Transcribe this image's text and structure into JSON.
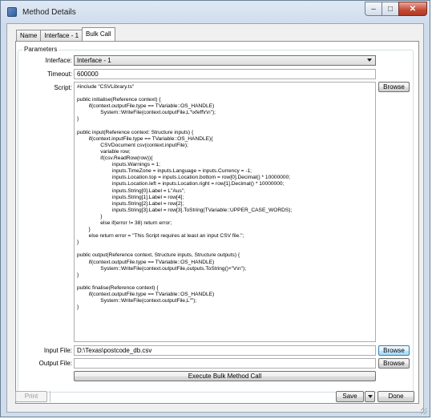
{
  "window": {
    "title": "Method Details",
    "minimize": "‒",
    "maximize": "□",
    "close": "✕"
  },
  "tabs": [
    "Name",
    "Interface - 1",
    "Bulk Call"
  ],
  "group": {
    "title": "Parameters"
  },
  "form": {
    "interface_label": "Interface:",
    "interface_value": "Interface - 1",
    "timeout_label": "Timeout:",
    "timeout_value": "600000",
    "script_label": "Script:",
    "script_lines": [
      "#include \"CSVLibrary.ts\"",
      "",
      "public initialise(Reference context) {",
      "\t\tif(context.outputFile.type == TVariable::OS_HANDLE)",
      "\t\t\t\tSystem::WriteFile(context.outputFile,L\"\\xfeff\\r\\n\");",
      "}",
      "",
      "public input(Reference context: Structure inputs) {",
      "\t\tif(context.inputFile.type == TVariable::OS_HANDLE){",
      "\t\t\t\tCSVDocument csv(context.inputFile);",
      "\t\t\t\tvariable row;",
      "\t\t\t\tif(csv.ReadRow(row)){",
      "\t\t\t\t\t\tinputs.Warnings = 1;",
      "\t\t\t\t\t\tinputs.TimeZone = inputs.Language = inputs.Currency = -1;",
      "\t\t\t\t\t\tinputs.Location.top = inputs.Location.bottom = row[0].Decimal() * 10000000;",
      "\t\t\t\t\t\tinputs.Location.left = inputs.Location.right = row[1].Decimal() * 10000000;",
      "\t\t\t\t\t\tinputs.String[0].Label = L\"Aus\";",
      "\t\t\t\t\t\tinputs.String[1].Label = row[4];",
      "\t\t\t\t\t\tinputs.String[2].Label = row[2];",
      "\t\t\t\t\t\tinputs.String[3].Label = row[3].ToString(TVariable::UPPER_CASE_WORDS);",
      "\t\t\t\t}",
      "\t\t\t\telse if(error != 38) return error;",
      "\t\t}",
      "\t\telse return error = \"This Script requires at least an input CSV file.\";",
      "}",
      "",
      "public output(Reference context, Structure inputs, Structure outputs) {",
      "\t\tif(context.outputFile.type == TVariable::OS_HANDLE)",
      "\t\t\t\tSystem::WriteFile(context.outputFile,outputs.ToString()+\"\\r\\n\");",
      "}",
      "",
      "public finalise(Reference context) {",
      "\t\tif(context.outputFile.type == TVariable::OS_HANDLE)",
      "\t\t\t\tSystem::WriteFile(context.outputFile,L\"\");",
      "}"
    ],
    "browse_label": "Browse",
    "input_file_label": "Input File:",
    "input_file_value": "D:\\Texas\\postcode_db.csv",
    "output_file_label": "Output File:",
    "output_file_value": "",
    "execute_label": "Execute Bulk Method Call"
  },
  "footer": {
    "print": "Print",
    "save": "Save",
    "done": "Done"
  }
}
